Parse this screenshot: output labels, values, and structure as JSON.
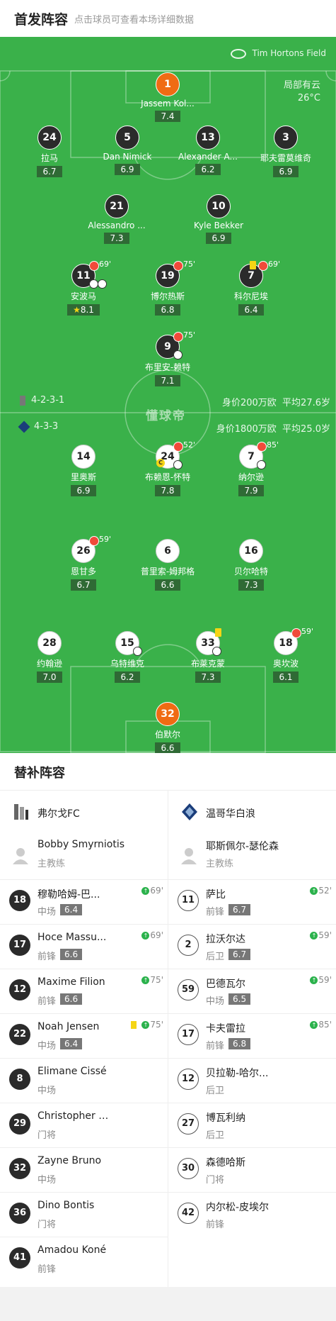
{
  "header": {
    "title": "首发阵容",
    "subtitle": "点击球员可查看本场详细数据"
  },
  "pitch": {
    "venue": "Tim Hortons Field",
    "weather_line1": "局部有云",
    "weather_line2": "26°C",
    "home_formation": "4-2-3-1",
    "home_value": "身价200万欧",
    "home_age": "平均27.6岁",
    "away_formation": "4-3-3",
    "away_value": "身价1800万欧",
    "away_age": "平均25.0岁",
    "watermark": "懂球帝",
    "colors": {
      "pitch": "#3ab14a",
      "rating": "#2f6a35",
      "goalkeeper": "#f06b13"
    }
  },
  "home_players": [
    {
      "num": "1",
      "name": "Jassem Kol...",
      "rating": "7.4",
      "style": "orange"
    },
    {
      "num": "24",
      "name": "拉马",
      "rating": "6.7",
      "style": "dark"
    },
    {
      "num": "5",
      "name": "Dan Nimick",
      "rating": "6.9",
      "style": "dark"
    },
    {
      "num": "13",
      "name": "Alexander A...",
      "rating": "6.2",
      "style": "dark"
    },
    {
      "num": "3",
      "name": "耶夫雷莫维奇",
      "rating": "6.9",
      "style": "dark"
    },
    {
      "num": "21",
      "name": "Alessandro ...",
      "rating": "7.3",
      "style": "dark"
    },
    {
      "num": "10",
      "name": "Kyle Bekker",
      "rating": "6.9",
      "style": "dark"
    },
    {
      "num": "11",
      "name": "安波马",
      "rating": "8.1",
      "style": "dark",
      "sub": "69'"
    },
    {
      "num": "19",
      "name": "博尔热斯",
      "rating": "6.8",
      "style": "dark",
      "sub": "75'"
    },
    {
      "num": "7",
      "name": "科尔尼埃",
      "rating": "6.4",
      "style": "dark",
      "sub": "69'"
    },
    {
      "num": "9",
      "name": "布里安-赖特",
      "rating": "7.1",
      "style": "dark",
      "sub": "75'"
    }
  ],
  "away_players": [
    {
      "num": "14",
      "name": "里奥斯",
      "rating": "6.9",
      "style": "light"
    },
    {
      "num": "24",
      "name": "布赖恩-怀特",
      "rating": "7.8",
      "style": "light",
      "sub": "52'"
    },
    {
      "num": "7",
      "name": "纳尔逊",
      "rating": "7.9",
      "style": "light",
      "sub": "85'"
    },
    {
      "num": "26",
      "name": "恩甘多",
      "rating": "6.7",
      "style": "light",
      "sub": "59'"
    },
    {
      "num": "6",
      "name": "普里索-姆邦格",
      "rating": "6.6",
      "style": "light"
    },
    {
      "num": "16",
      "name": "贝尔哈特",
      "rating": "7.3",
      "style": "light"
    },
    {
      "num": "28",
      "name": "约翰逊",
      "rating": "7.0",
      "style": "light"
    },
    {
      "num": "15",
      "name": "乌特维克",
      "rating": "6.2",
      "style": "light"
    },
    {
      "num": "33",
      "name": "布莱克蒙",
      "rating": "7.3",
      "style": "light"
    },
    {
      "num": "18",
      "name": "奥坎波",
      "rating": "6.1",
      "style": "light",
      "sub": "59'"
    },
    {
      "num": "32",
      "name": "伯默尔",
      "rating": "6.6",
      "style": "orange"
    }
  ],
  "subs": {
    "title": "替补阵容",
    "home_team": "弗尔戈FC",
    "away_team": "温哥华白浪",
    "home_coach": {
      "name": "Bobby Smyrniotis",
      "role": "主教练"
    },
    "away_coach": {
      "name": "耶斯佩尔-瑟伦森",
      "role": "主教练"
    },
    "home": [
      {
        "num": "18",
        "name": "穆勒哈姆-巴...",
        "pos": "中场",
        "rating": "6.4",
        "time": "69'"
      },
      {
        "num": "17",
        "name": "Hoce Massu...",
        "pos": "前锋",
        "rating": "6.6",
        "time": "69'"
      },
      {
        "num": "12",
        "name": "Maxime Filion",
        "pos": "前锋",
        "rating": "6.6",
        "time": "75'"
      },
      {
        "num": "22",
        "name": "Noah Jensen",
        "pos": "中场",
        "rating": "6.4",
        "time": "75'"
      },
      {
        "num": "8",
        "name": "Elimane Cissé",
        "pos": "中场"
      },
      {
        "num": "29",
        "name": "Christopher K...",
        "pos": "门将"
      },
      {
        "num": "32",
        "name": "Zayne Bruno",
        "pos": "中场"
      },
      {
        "num": "36",
        "name": "Dino Bontis",
        "pos": "门将"
      },
      {
        "num": "41",
        "name": "Amadou Koné",
        "pos": "前锋"
      }
    ],
    "away": [
      {
        "num": "11",
        "name": "萨比",
        "pos": "前锋",
        "rating": "6.7",
        "time": "52'"
      },
      {
        "num": "2",
        "name": "拉沃尔达",
        "pos": "后卫",
        "rating": "6.7",
        "time": "59'"
      },
      {
        "num": "59",
        "name": "巴德瓦尔",
        "pos": "中场",
        "rating": "6.5",
        "time": "59'"
      },
      {
        "num": "17",
        "name": "卡夫雷拉",
        "pos": "前锋",
        "rating": "6.8",
        "time": "85'"
      },
      {
        "num": "12",
        "name": "贝拉勒-哈尔...",
        "pos": "后卫"
      },
      {
        "num": "27",
        "name": "博瓦利纳",
        "pos": "后卫"
      },
      {
        "num": "30",
        "name": "森德哈斯",
        "pos": "门将"
      },
      {
        "num": "42",
        "name": "内尔松-皮埃尔",
        "pos": "前锋"
      }
    ]
  }
}
